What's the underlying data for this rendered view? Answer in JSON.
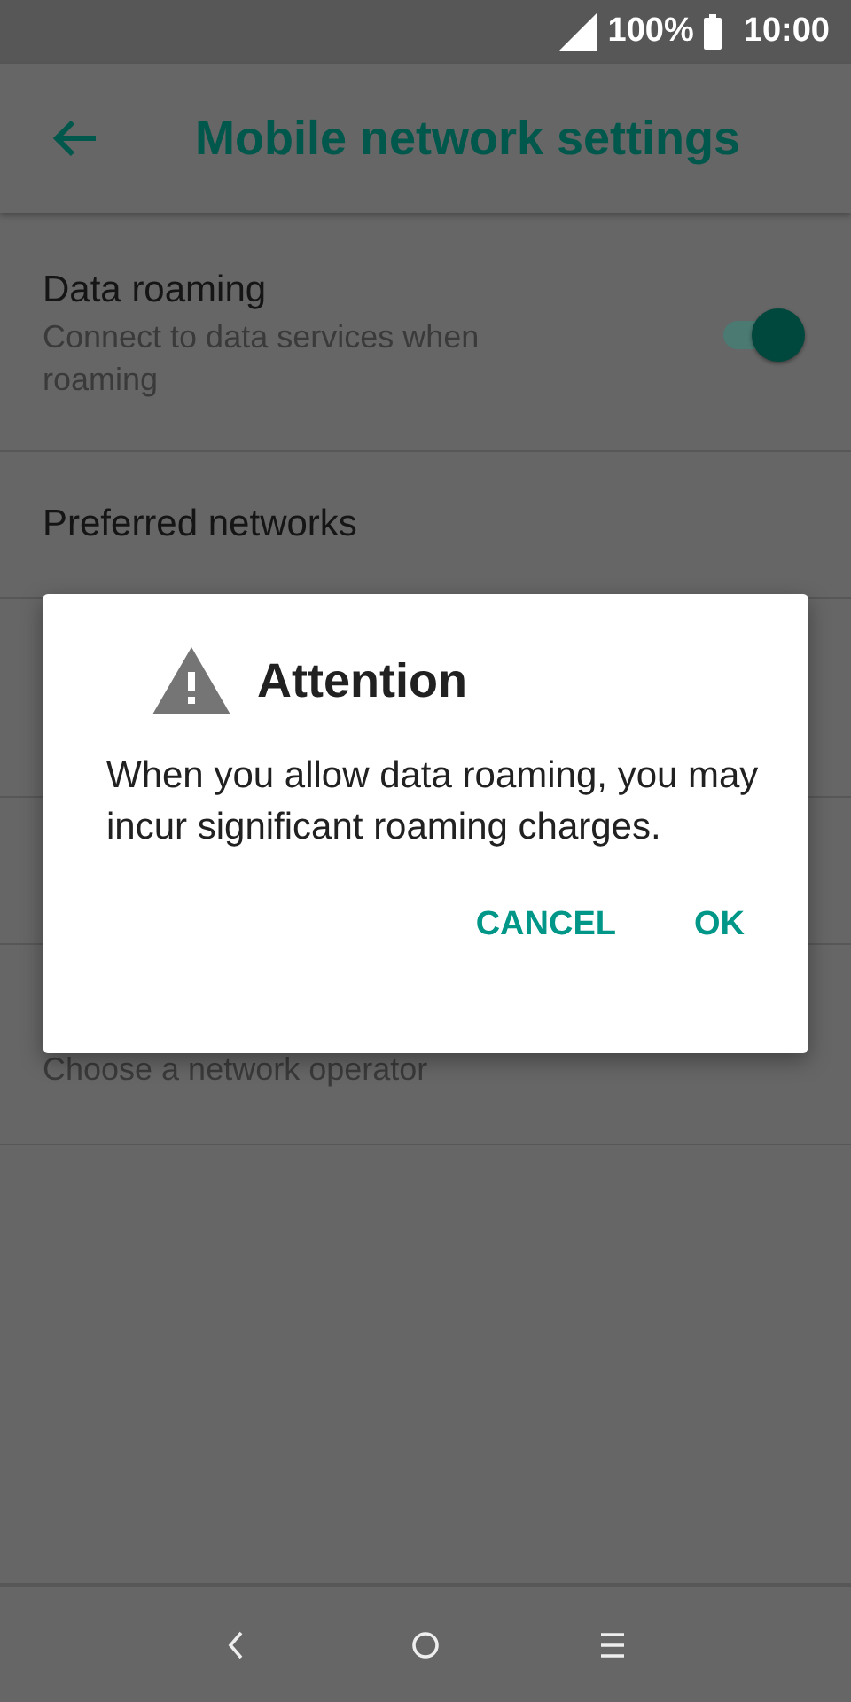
{
  "status_bar": {
    "battery": "100%",
    "time": "10:00"
  },
  "toolbar": {
    "title": "Mobile network settings"
  },
  "settings": [
    {
      "kind": "double",
      "title": "Data roaming",
      "subtitle": "Connect to data services when roaming",
      "switch_on": true
    },
    {
      "kind": "single",
      "title": "Preferred networks"
    },
    {
      "kind": "double"
    },
    {
      "kind": "single"
    },
    {
      "kind": "double",
      "subtitle": "Choose a network operator"
    }
  ],
  "dialog": {
    "title": "Attention",
    "message": "When you allow data roaming, you may incur significant roaming charges.",
    "buttons": [
      "CANCEL",
      "OK"
    ]
  }
}
